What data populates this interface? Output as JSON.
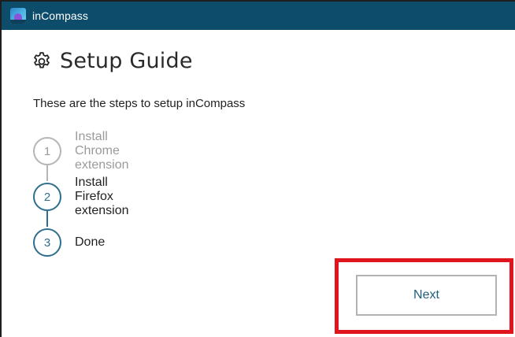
{
  "window": {
    "title": "inCompass",
    "titlebar_color": "#0d4d6b",
    "icon": "incompass-app-icon"
  },
  "page": {
    "title": "Setup Guide",
    "title_icon": "gear-icon",
    "intro": "These are the steps to setup inCompass"
  },
  "steps": [
    {
      "number": "1",
      "label": "Install Chrome extension",
      "state": "completed"
    },
    {
      "number": "2",
      "label": "Install Firefox extension",
      "state": "current"
    },
    {
      "number": "3",
      "label": "Done",
      "state": "pending"
    }
  ],
  "actions": {
    "next_label": "Next"
  },
  "colors": {
    "accent": "#2e6f8e",
    "completed": "#b5b5b5",
    "highlight": "#e0141c"
  }
}
